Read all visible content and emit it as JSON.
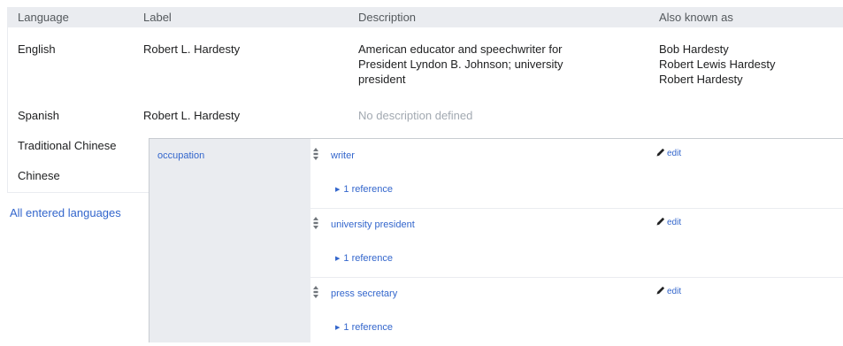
{
  "languages_table": {
    "headers": {
      "language": "Language",
      "label": "Label",
      "description": "Description",
      "also_known_as": "Also known as"
    },
    "rows": [
      {
        "language": "English",
        "label": "Robert L. Hardesty",
        "description_lines": [
          "American educator and speechwriter for",
          "President Lyndon B. Johnson; university",
          "president"
        ],
        "aliases": [
          "Bob Hardesty",
          "Robert Lewis Hardesty",
          "Robert Hardesty"
        ]
      },
      {
        "language": "Spanish",
        "label": "Robert L. Hardesty",
        "description_placeholder": "No description defined"
      },
      {
        "language": "Traditional Chinese"
      },
      {
        "language": "Chinese"
      }
    ],
    "all_languages_link": "All entered languages"
  },
  "statements": {
    "property": "occupation",
    "items": [
      {
        "value": "writer",
        "edit_label": "edit",
        "references": "1 reference"
      },
      {
        "value": "university president",
        "edit_label": "edit",
        "references": "1 reference"
      },
      {
        "value": "press secretary",
        "edit_label": "edit",
        "references": "1 reference"
      }
    ]
  },
  "icons": {
    "rank": "rank-normal-icon",
    "edit": "pencil-icon",
    "expand": "triangle-right-icon"
  },
  "colors": {
    "link": "#3366cc",
    "header_bg": "#eaecf0",
    "muted_text": "#a2a9b1"
  }
}
